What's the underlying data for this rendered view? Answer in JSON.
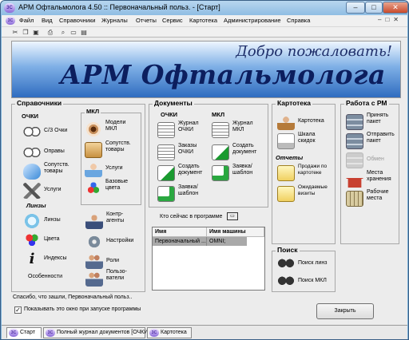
{
  "window": {
    "title": "АРМ Офтальмолога 4.50 :: Первоначальный польз. - [Старт]",
    "minimize": "–",
    "maximize": "□",
    "close": "✕"
  },
  "app_icon": "3C",
  "menu": [
    "Файл",
    "Вид",
    "Справочники",
    "Журналы",
    "Отчеты",
    "Сервис",
    "Картотека",
    "Администрирование",
    "Справка"
  ],
  "banner": {
    "welcome": "Добро пожаловать!",
    "title": "АРМ Офтальмолога"
  },
  "spravochniki": {
    "title": "Справочники",
    "ochki_title": "ОЧКИ",
    "ochki": [
      "С/З Очки",
      "Оправы",
      "Сопутств.\nтовары",
      "Услуги"
    ],
    "linzy_title": "Линзы",
    "linzy": [
      "Линзы",
      "Цвета",
      "Индексы"
    ],
    "osobennosti": "Особенности",
    "mkl_title": "МКЛ",
    "mkl": [
      "Модели\nМКЛ",
      "Сопутств.\nтовары",
      "Услуги",
      "Базовые\nцвета"
    ],
    "other": [
      "Контр-\nагенты",
      "Настройки",
      "Роли",
      "Пользо-\nватели"
    ]
  },
  "dokumenty": {
    "title": "Документы",
    "ochki_title": "ОЧКИ",
    "ochki": [
      "Журнал\nОЧКИ",
      "Заказы\nОЧКИ",
      "Создать\nдокумент",
      "Заявка/\nшаблон"
    ],
    "mkl_title": "МКЛ",
    "mkl": [
      "Журнал\nМКЛ",
      "Создать\nдокумент",
      "Заявка/\nшаблон"
    ]
  },
  "kartoteka": {
    "title": "Картотека",
    "items": [
      "Картотека",
      "Шкала\nскидок"
    ],
    "otchety_title": "Отчеты",
    "otchety": [
      "Продажи по\nкартотеке",
      "Ожидаемые\nвизиты"
    ]
  },
  "rabota": {
    "title": "Работа с РМ",
    "items": [
      "Принять\nпакет",
      "Отправить\nпакет",
      "Обмен",
      "Места\nхранения",
      "Рабочие\nместа"
    ]
  },
  "who_online": {
    "label": "Кто сейчас в программе",
    "columns": [
      "Имя",
      "Имя машины"
    ],
    "rows": [
      [
        "Первоначальный ...",
        "OMNI;"
      ]
    ]
  },
  "poisk": {
    "title": "Поиск",
    "items": [
      "Поиск линз",
      "Поиск МКЛ"
    ]
  },
  "status_text": "Спасибо, что зашли, Первоначальный польз..",
  "show_on_start": "Показывать это окно при запуске программы",
  "close_button": "Закрыть",
  "tabs": [
    "Старт",
    "Полный журнал документов [ОЧКИ]",
    "Картотека"
  ]
}
